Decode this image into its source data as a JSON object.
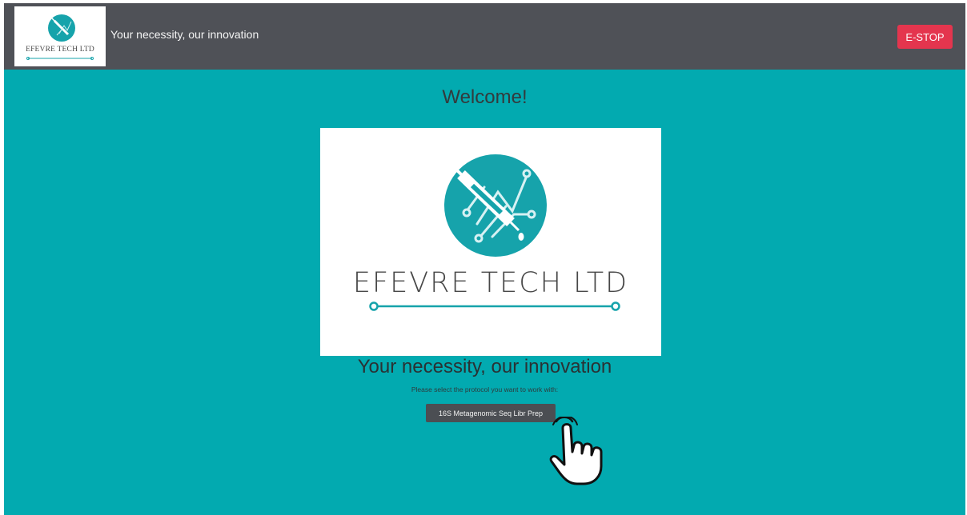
{
  "header": {
    "logo_text": "EFEVRE TECH LTD",
    "tagline": "Your necessity, our innovation",
    "estop_label": "E-STOP"
  },
  "main": {
    "welcome": "Welcome!",
    "hero_wordmark": "EFEVRE TECH LTD",
    "tagline": "Your necessity, our innovation",
    "prompt": "Please select the protocol you want to work with:",
    "protocols": [
      {
        "label": "16S Metagenomic Seq Libr Prep"
      }
    ]
  },
  "colors": {
    "background": "#02aab0",
    "header": "#4f5157",
    "estop": "#e4354e",
    "button": "#4b4e53",
    "logo_teal": "#16a3ab"
  },
  "icons": [
    "syringe-circuit-logo-icon",
    "hand-pointer-icon"
  ]
}
